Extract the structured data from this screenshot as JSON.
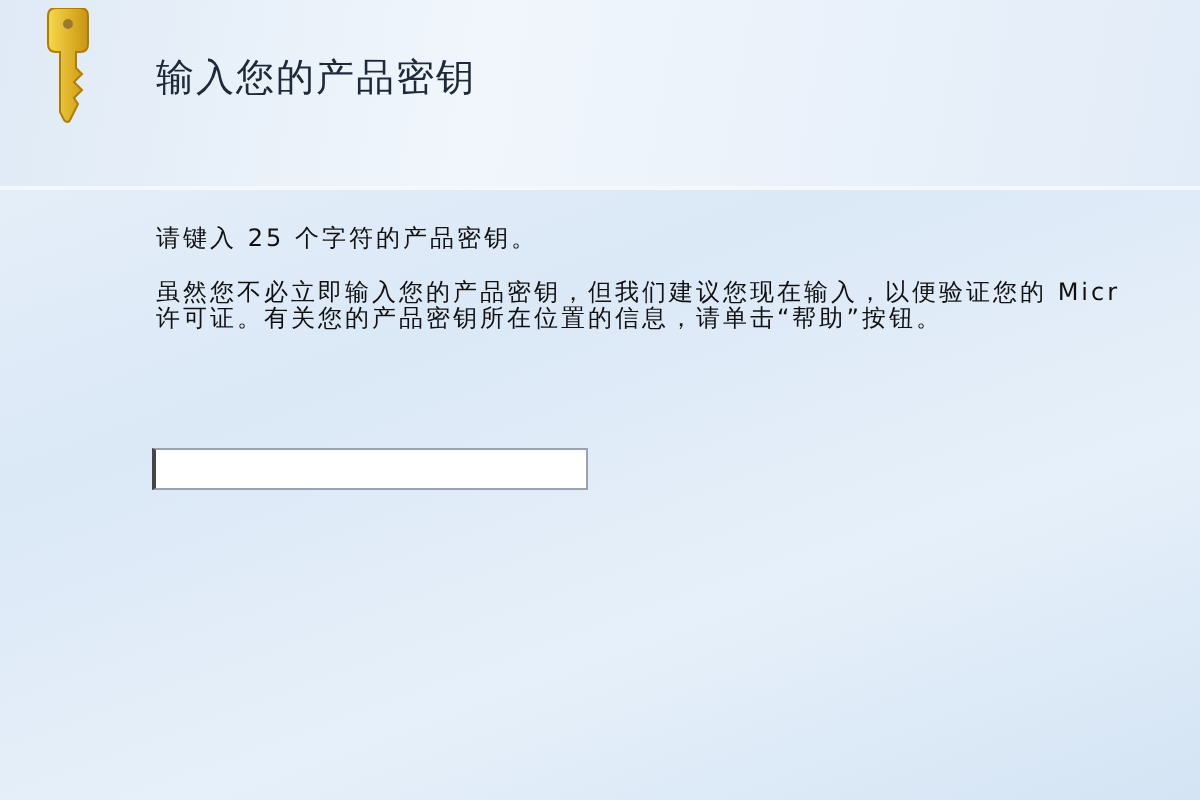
{
  "header": {
    "title": "输入您的产品密钥"
  },
  "body": {
    "instruction": "请键入 25 个字符的产品密钥。",
    "paragraph_lines": [
      "虽然您不必立即输入您的产品密钥，但我们建议您现在输入，以便验证您的 Micr",
      "许可证。有关您的产品密钥所在位置的信息，请单击“帮助”按钮。"
    ]
  },
  "key_field": {
    "focused": true
  }
}
